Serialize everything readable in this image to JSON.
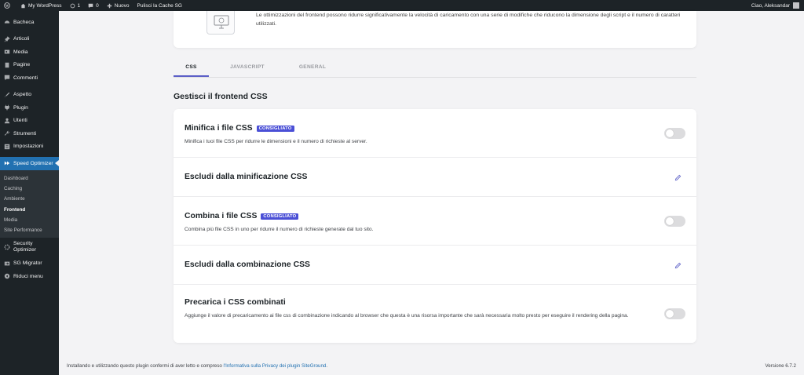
{
  "adminbar": {
    "site_name": "My WordPress",
    "updates_count": "1",
    "comments_count": "0",
    "new_label": "Nuovo",
    "cache_label": "Pulisci la Cache SG",
    "greeting": "Ciao, Aleksandar"
  },
  "sidebar": {
    "items": [
      {
        "label": "Bacheca",
        "icon": "dashboard-icon"
      },
      {
        "label": "Articoli",
        "icon": "pin-icon"
      },
      {
        "label": "Media",
        "icon": "media-icon"
      },
      {
        "label": "Pagine",
        "icon": "page-icon"
      },
      {
        "label": "Commenti",
        "icon": "comment-icon"
      },
      {
        "label": "Aspetto",
        "icon": "brush-icon"
      },
      {
        "label": "Plugin",
        "icon": "plugin-icon"
      },
      {
        "label": "Utenti",
        "icon": "user-icon"
      },
      {
        "label": "Strumenti",
        "icon": "wrench-icon"
      },
      {
        "label": "Impostazioni",
        "icon": "settings-icon"
      },
      {
        "label": "Speed Optimizer",
        "icon": "speed-icon"
      }
    ],
    "submenu": [
      "Dashboard",
      "Caching",
      "Ambiente",
      "Frontend",
      "Media",
      "Site Performance"
    ],
    "after": [
      {
        "label": "Security Optimizer",
        "icon": "security-icon"
      },
      {
        "label": "SG Migrator",
        "icon": "migrator-icon"
      },
      {
        "label": "Riduci menu",
        "icon": "collapse-icon"
      }
    ]
  },
  "topcard": {
    "text": "Le ottimizzazioni del frontend possono ridurre significativamente la velocità di caricamento con una serie di modifiche che riducono la dimensione degli script e il numero di caratteri utilizzati."
  },
  "tabs": [
    "CSS",
    "JAVASCRIPT",
    "GENERAL"
  ],
  "section_title": "Gestisci il frontend CSS",
  "rows": [
    {
      "title": "Minifica i file CSS",
      "badge": "CONSIGLIATO",
      "desc": "Minifica i tuoi file CSS per ridurre le dimensioni e il numero di richieste al server."
    },
    {
      "title": "Escludi dalla minificazione CSS"
    },
    {
      "title": "Combina i file CSS",
      "badge": "CONSIGLIATO",
      "desc": "Combina più file CSS in uno per ridurre il numero di richieste generate dal tuo sito."
    },
    {
      "title": "Escludi dalla combinazione CSS"
    },
    {
      "title": "Precarica i CSS combinati",
      "desc": "Aggiunge il valore di precaricamento ai file css di combinazione indicando al browser che questa è una risorsa importante che sarà necessaria molto presto per eseguire il rendering della pagina."
    }
  ],
  "footer": {
    "text": "Installando e utilizzando questo plugin confermi di aver letto e compreso",
    "link": "l'Informativa sulla Privacy dei plugin SiteGround",
    "end": ".",
    "version": "Versione 6.7.2"
  },
  "colors": {
    "accent": "#4a4fd6",
    "wp_blue": "#2271b1",
    "sidebar_bg": "#1d2327"
  }
}
